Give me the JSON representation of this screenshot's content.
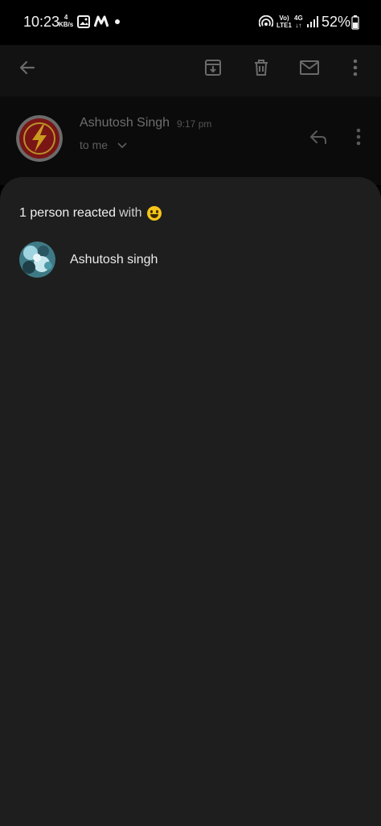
{
  "status_bar": {
    "time": "10:23",
    "speed_value": "4",
    "speed_unit": "KB/s",
    "volte": "Vo)",
    "lte": "LTE1",
    "network": "4G",
    "battery_percent": "52%"
  },
  "app_bar": {
    "icons": [
      "back-arrow-icon",
      "archive-icon",
      "delete-icon",
      "mark-unread-icon",
      "more-vert-icon"
    ]
  },
  "email": {
    "sender": "Ashutosh Singh",
    "time": "9:17 pm",
    "recipient": "to me"
  },
  "reactions_sheet": {
    "count_text": "1 person reacted",
    "with_text": "with",
    "emoji": "grinning-face-emoji",
    "people": [
      {
        "name": "Ashutosh singh"
      }
    ]
  },
  "colors": {
    "background": "#000000",
    "sheet": "#1e1e1e",
    "accent_logo_red": "#8b1a1a",
    "accent_logo_yellow": "#e0b020"
  }
}
